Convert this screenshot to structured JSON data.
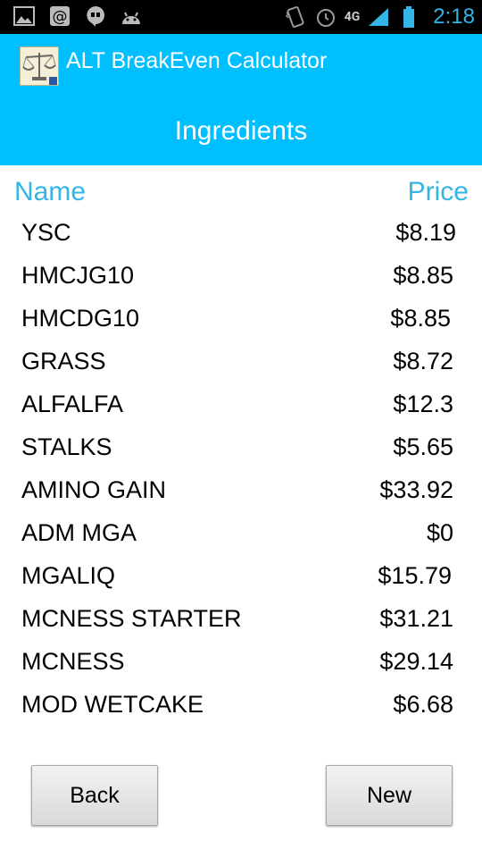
{
  "status_bar": {
    "time": "2:18",
    "network": "4G",
    "icons": [
      "image-icon",
      "at-icon",
      "hangouts-icon",
      "android-icon",
      "vibrate-icon",
      "alarm-icon",
      "signal-icon",
      "battery-icon"
    ]
  },
  "header": {
    "app_title": "ALT BreakEven Calculator",
    "screen_title": "Ingredients"
  },
  "columns": {
    "name": "Name",
    "price": "Price"
  },
  "ingredients": [
    {
      "name": "YSC",
      "price": "$8.19"
    },
    {
      "name": "HMCJG10",
      "price": "$8.85"
    },
    {
      "name": "HMCDG10",
      "price": "$8.85"
    },
    {
      "name": "GRASS",
      "price": "$8.72"
    },
    {
      "name": "ALFALFA",
      "price": "$12.3"
    },
    {
      "name": "STALKS",
      "price": "$5.65"
    },
    {
      "name": "AMINO GAIN",
      "price": "$33.92"
    },
    {
      "name": "ADM MGA",
      "price": "$0"
    },
    {
      "name": "MGALIQ",
      "price": "$15.79"
    },
    {
      "name": "MCNESS STARTER",
      "price": "$31.21"
    },
    {
      "name": "MCNESS",
      "price": "$29.14"
    },
    {
      "name": "MOD WETCAKE",
      "price": "$6.68"
    }
  ],
  "buttons": {
    "back": "Back",
    "new": "New"
  },
  "colors": {
    "accent": "#00bfff",
    "header_text": "#33b5e5"
  }
}
